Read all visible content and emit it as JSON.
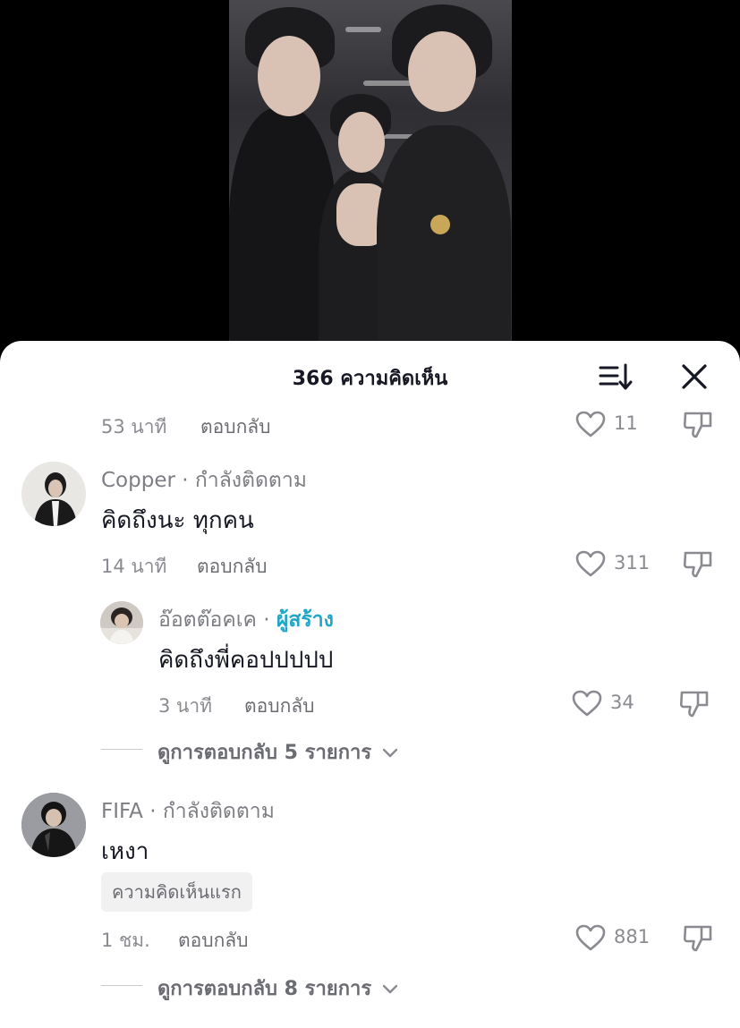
{
  "sheet": {
    "title": "366 ความคิดเห็น",
    "sort_icon": "sort-descending-icon",
    "close_icon": "close-icon"
  },
  "comments": [
    {
      "time": "53 นาที",
      "reply_label": "ตอบกลับ",
      "likes": "11"
    },
    {
      "username": "Copper",
      "follow_status": "กำลังติดตาม",
      "text": "คิดถึงนะ ทุกคน",
      "time": "14 นาที",
      "reply_label": "ตอบกลับ",
      "likes": "311",
      "reply": {
        "username": "อ๊อตต๊อคเค",
        "creator_label": "ผู้สร้าง",
        "text": "คิดถึงพี่คอปปปปป",
        "time": "3 นาที",
        "reply_label": "ตอบกลับ",
        "likes": "34"
      },
      "view_replies": "ดูการตอบกลับ 5 รายการ"
    },
    {
      "username": "FIFA",
      "follow_status": "กำลังติดตาม",
      "text": "เหงา",
      "badge": "ความคิดเห็นแรก",
      "time": "1 ชม.",
      "reply_label": "ตอบกลับ",
      "likes": "881",
      "view_replies": "ดูการตอบกลับ 8 รายการ"
    }
  ],
  "separator": "·",
  "colors": {
    "creator": "#20a6c6",
    "text": "#161823",
    "muted": "#8a8b91"
  }
}
